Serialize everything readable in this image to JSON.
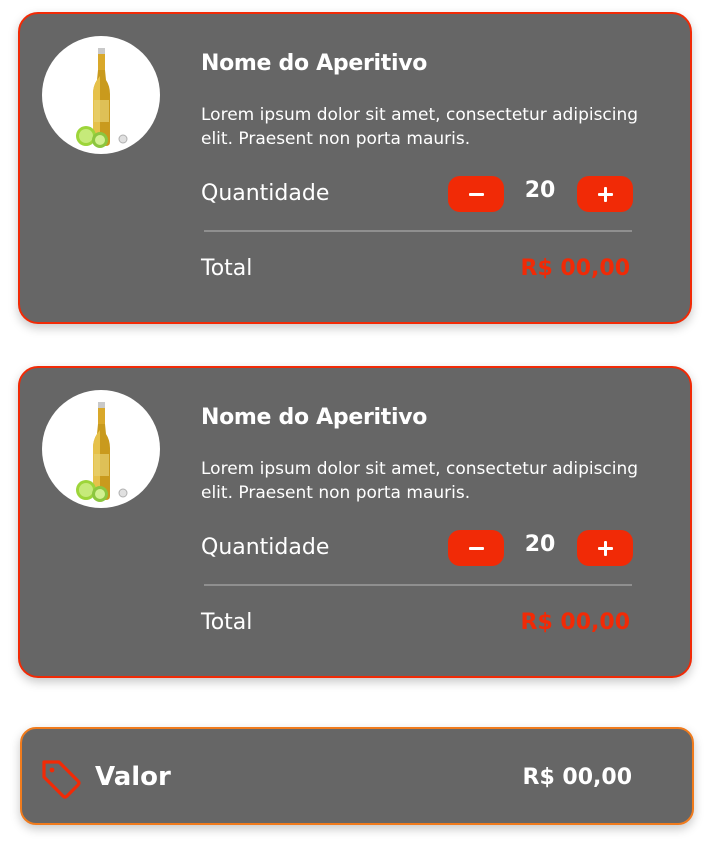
{
  "items": [
    {
      "name": "Nome do Aperitivo",
      "description": "Lorem ipsum dolor sit amet, consectetur adipiscing elit. Praesent non porta mauris.",
      "quantity_label": "Quantidade",
      "quantity": "20",
      "total_label": "Total",
      "total": "R$ 00,00",
      "image": "beer-bottle-with-lime"
    },
    {
      "name": "Nome do Aperitivo",
      "description": "Lorem ipsum dolor sit amet, consectetur adipiscing elit. Praesent non porta mauris.",
      "quantity_label": "Quantidade",
      "quantity": "20",
      "total_label": "Total",
      "total": "R$ 00,00",
      "image": "beer-bottle-with-lime"
    }
  ],
  "summary": {
    "icon": "price-tag-icon",
    "label": "Valor",
    "value": "R$ 00,00"
  },
  "colors": {
    "card_bg": "#666666",
    "accent": "#f12a06",
    "summary_border": "#f07b1d",
    "text": "#ffffff"
  }
}
